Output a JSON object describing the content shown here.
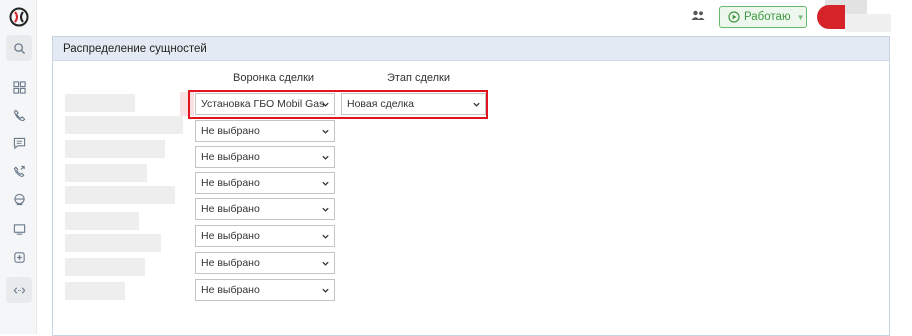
{
  "topbar": {
    "status_label": "Работаю",
    "status_color": "#3d9a41",
    "user_avatar_color": "#d6232a"
  },
  "sidebar": {
    "items": [
      {
        "icon": "search-icon"
      },
      {
        "icon": "dashboard-icon"
      },
      {
        "icon": "phone-icon"
      },
      {
        "icon": "chat-icon"
      },
      {
        "icon": "call-forward-icon"
      },
      {
        "icon": "robot-icon"
      },
      {
        "icon": "message-icon"
      },
      {
        "icon": "shield-icon"
      },
      {
        "icon": "integration-icon"
      }
    ]
  },
  "panel": {
    "title": "Распределение сущностей",
    "col_funnel": "Воронка сделки",
    "col_stage": "Этап сделки"
  },
  "rows": [
    {
      "funnel": "Установка ГБО Mobil Gas",
      "stage": "Новая сделка"
    },
    {
      "funnel": "Не выбрано"
    },
    {
      "funnel": "Не выбрано"
    },
    {
      "funnel": "Не выбрано"
    },
    {
      "funnel": "Не выбрано"
    },
    {
      "funnel": "Не выбрано"
    },
    {
      "funnel": "Не выбрано"
    },
    {
      "funnel": "Не выбрано"
    }
  ]
}
